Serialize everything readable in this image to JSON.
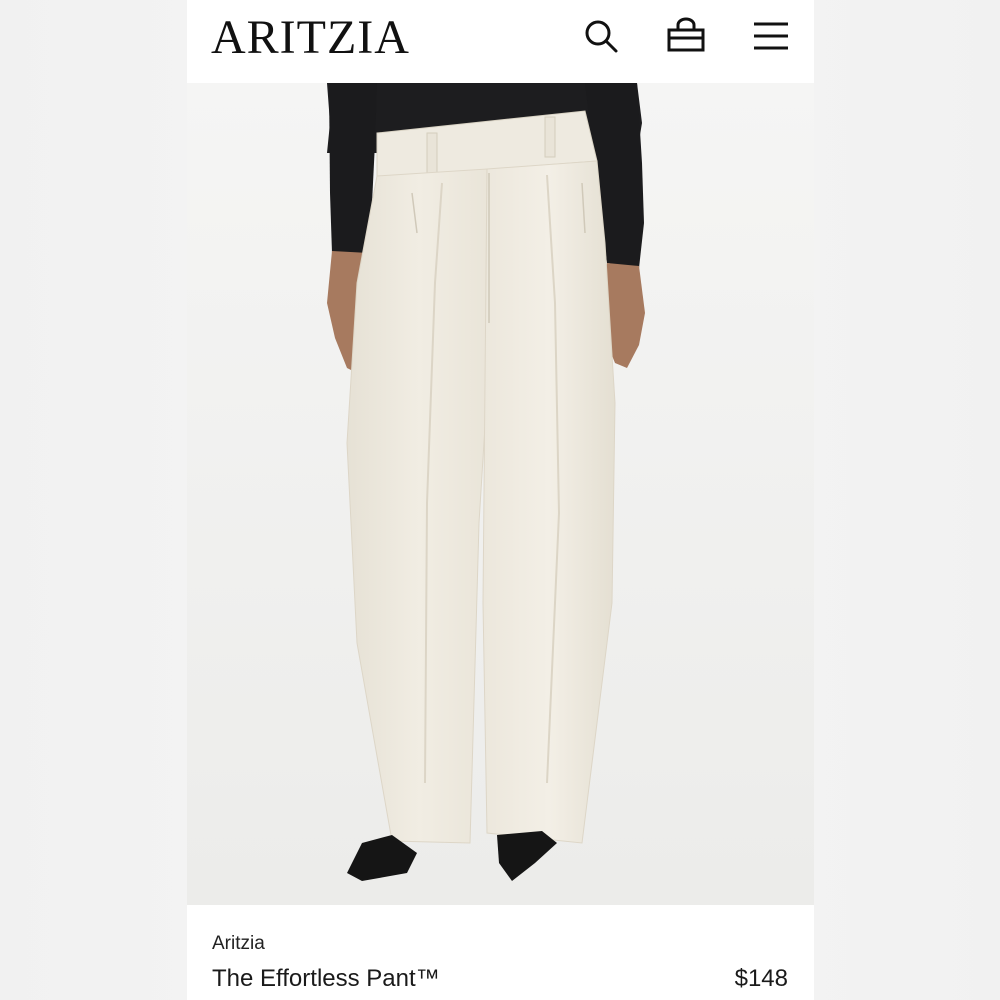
{
  "header": {
    "logo": "ARITZIA",
    "icons": [
      "search-icon",
      "bag-icon",
      "menu-icon"
    ]
  },
  "hero": {
    "image": "product-photo"
  },
  "product": {
    "brand": "Aritzia",
    "name": "The Effortless Pant™",
    "price": "$148"
  },
  "colors": {
    "text": "#111111",
    "pant": "#eeeae0",
    "top": "#1d1d1f",
    "shoe": "#151515"
  }
}
